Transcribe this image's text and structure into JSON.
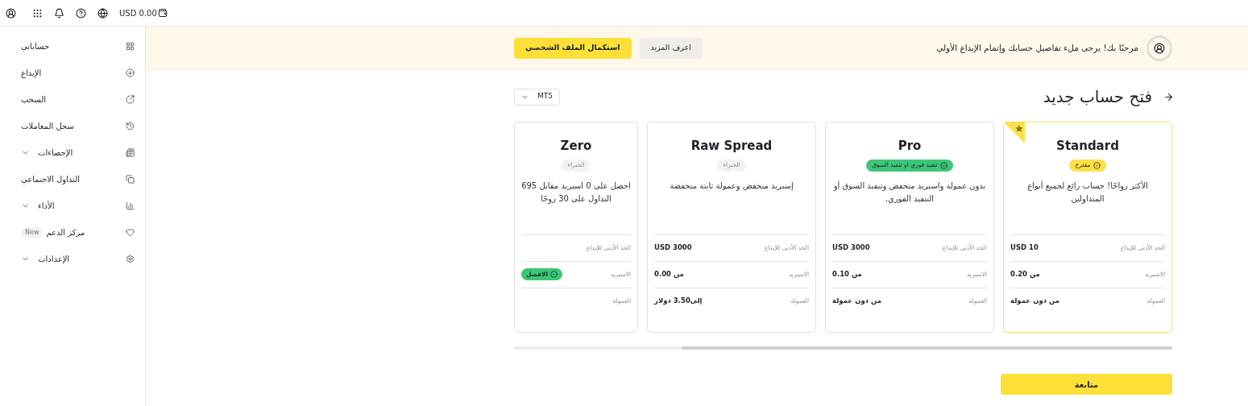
{
  "top_bar": {
    "balance": "USD 0.00"
  },
  "sidebar": {
    "items": [
      {
        "label": "حساباتي",
        "kind": "link"
      },
      {
        "label": "الإيداع",
        "kind": "link"
      },
      {
        "label": "السحب",
        "kind": "link"
      },
      {
        "label": "سجل المعاملات",
        "kind": "link"
      },
      {
        "label": "الإحصاءات",
        "kind": "group"
      },
      {
        "label": "التداول الاجتماعي",
        "kind": "link"
      },
      {
        "label": "الأداء",
        "kind": "group"
      },
      {
        "label": "مركز الدعم",
        "kind": "link",
        "badge": "New"
      },
      {
        "label": "الإعدادات",
        "kind": "group"
      }
    ]
  },
  "banner": {
    "message": "مرحبًا بك! يرجى ملء تفاصيل حسابك وإتمام الإيداع الأولي",
    "learn_more": "اعرف المزيد",
    "complete_profile": "استكمال الملف الشخصي"
  },
  "section": {
    "title": "فتح حساب جديد",
    "platform": "MT5"
  },
  "cards": [
    {
      "name": "Standard",
      "selected": true,
      "badge": {
        "text": "مقترح",
        "kind": "highlight",
        "color": "#fde047"
      },
      "description": "الأكثر رواجًا! حساب رائع لجميع أنواع المتداولين",
      "rows": [
        {
          "label": "الحد الأدنى للإيداع",
          "value": "USD 10"
        },
        {
          "label": "الاسبريد",
          "value": "من 0.20"
        },
        {
          "label": "العمولة",
          "value": "من دون عمولة"
        }
      ]
    },
    {
      "name": "Pro",
      "selected": false,
      "badge": {
        "text": "تنفيذ فوري او تنفيذ السوق",
        "kind": "highlight",
        "color": "#3dc578"
      },
      "description": "بدون عمولة واسبريد منخفض وتنفيذ السوق أو التنفيذ الفوري.",
      "rows": [
        {
          "label": "الحد الأدنى للإيداع",
          "value": "USD 3000"
        },
        {
          "label": "الاسبريد",
          "value": "من 0.10"
        },
        {
          "label": "العمولة",
          "value": "من دون عمولة"
        }
      ]
    },
    {
      "name": "Raw Spread",
      "selected": false,
      "badge": {
        "text": "الخبراء",
        "kind": "plain",
        "color": "#f1f2f4"
      },
      "description": "إسبريد منخفض وعمولة ثابتة منخفضة",
      "rows": [
        {
          "label": "الحد الأدنى للإيداع",
          "value": "USD 3000"
        },
        {
          "label": "الاسبريد",
          "value": "من 0.00"
        },
        {
          "label": "العمولة",
          "value": "إلى3.50 دولار"
        }
      ]
    },
    {
      "name": "Zero",
      "selected": false,
      "badge": {
        "text": "الخبراء",
        "kind": "plain",
        "color": "#f1f2f4"
      },
      "description": "احصل على 0 اسبريد مقابل 695 التداول على 30 زوجًا",
      "rows": [
        {
          "label": "الحد الأدنى للإيداع"
        },
        {
          "label": "الاسبريد",
          "tag": "الافضل"
        },
        {
          "label": "العمولة"
        }
      ]
    }
  ],
  "continue_button": "متابعة"
}
